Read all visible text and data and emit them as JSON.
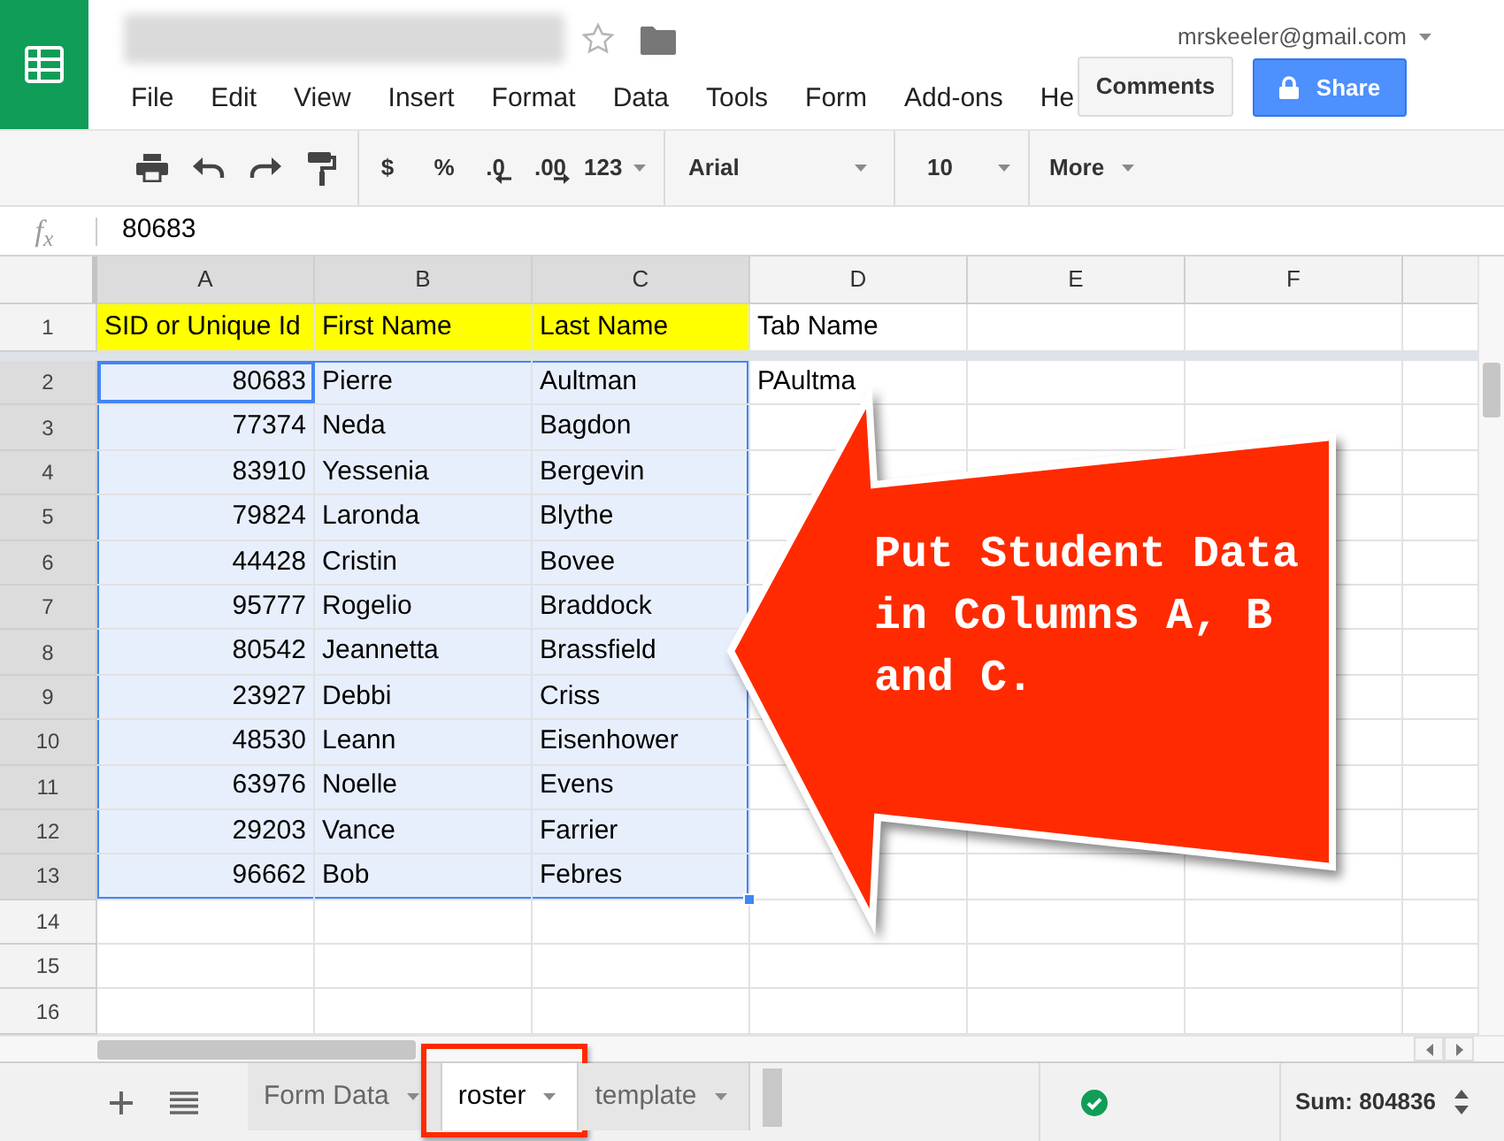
{
  "document": {
    "starred": false
  },
  "account": {
    "email": "mrskeeler@gmail.com"
  },
  "menu": [
    "File",
    "Edit",
    "View",
    "Insert",
    "Format",
    "Data",
    "Tools",
    "Form",
    "Add-ons",
    "He"
  ],
  "actions": {
    "comments": "Comments",
    "share": "Share"
  },
  "toolbar": {
    "currency": "$",
    "percent": "%",
    "decrease_decimals": ".0",
    "increase_decimals": ".00",
    "number_format": "123",
    "font": "Arial",
    "font_size": "10",
    "more": "More"
  },
  "formula_bar": {
    "label": "f$_{x}$",
    "value": "80683"
  },
  "sheet": {
    "columns": [
      {
        "label": "A",
        "selected": true
      },
      {
        "label": "B",
        "selected": true
      },
      {
        "label": "C",
        "selected": true
      },
      {
        "label": "D",
        "selected": false
      },
      {
        "label": "E",
        "selected": false
      },
      {
        "label": "F",
        "selected": false
      }
    ],
    "header_row": {
      "number": "1",
      "selected": false,
      "active": false,
      "cells": [
        {
          "text": "SID or Unique Id",
          "color": "#ffff00"
        },
        {
          "text": "First Name",
          "color": "#ffff00"
        },
        {
          "text": "Last Name",
          "color": "#ffff00"
        },
        {
          "text": "Tab Name"
        }
      ]
    },
    "rows": [
      {
        "number": "2",
        "selected": true,
        "active": true,
        "cells": [
          "80683",
          "Pierre",
          "Aultman",
          "PAultma"
        ]
      },
      {
        "number": "3",
        "selected": true,
        "active": false,
        "cells": [
          "77374",
          "Neda",
          "Bagdon"
        ]
      },
      {
        "number": "4",
        "selected": true,
        "active": false,
        "cells": [
          "83910",
          "Yessenia",
          "Bergevin"
        ]
      },
      {
        "number": "5",
        "selected": true,
        "active": false,
        "cells": [
          "79824",
          "Laronda",
          "Blythe"
        ]
      },
      {
        "number": "6",
        "selected": true,
        "active": false,
        "cells": [
          "44428",
          "Cristin",
          "Bovee"
        ]
      },
      {
        "number": "7",
        "selected": true,
        "active": false,
        "cells": [
          "95777",
          "Rogelio",
          "Braddock"
        ]
      },
      {
        "number": "8",
        "selected": true,
        "active": false,
        "cells": [
          "80542",
          "Jeannetta",
          "Brassfield"
        ]
      },
      {
        "number": "9",
        "selected": true,
        "active": false,
        "cells": [
          "23927",
          "Debbi",
          "Criss"
        ]
      },
      {
        "number": "10",
        "selected": true,
        "active": false,
        "cells": [
          "48530",
          "Leann",
          "Eisenhower"
        ]
      },
      {
        "number": "11",
        "selected": true,
        "active": false,
        "cells": [
          "63976",
          "Noelle",
          "Evens"
        ]
      },
      {
        "number": "12",
        "selected": true,
        "active": false,
        "cells": [
          "29203",
          "Vance",
          "Farrier"
        ]
      },
      {
        "number": "13",
        "selected": true,
        "active": false,
        "cells": [
          "96662",
          "Bob",
          "Febres"
        ]
      },
      {
        "number": "14",
        "selected": false,
        "active": false
      },
      {
        "number": "15",
        "selected": false,
        "active": false
      },
      {
        "number": "16",
        "selected": false,
        "active": false
      }
    ]
  },
  "sheet_tabs": [
    {
      "label": "Form Data",
      "selected": false,
      "highlighted": false
    },
    {
      "label": "roster",
      "selected": true,
      "highlighted": true
    },
    {
      "label": "template",
      "selected": false,
      "highlighted": false
    }
  ],
  "status": {
    "sum": "Sum: 804836"
  },
  "callout": {
    "text": "Put Student Data in Columns A, B and C."
  }
}
